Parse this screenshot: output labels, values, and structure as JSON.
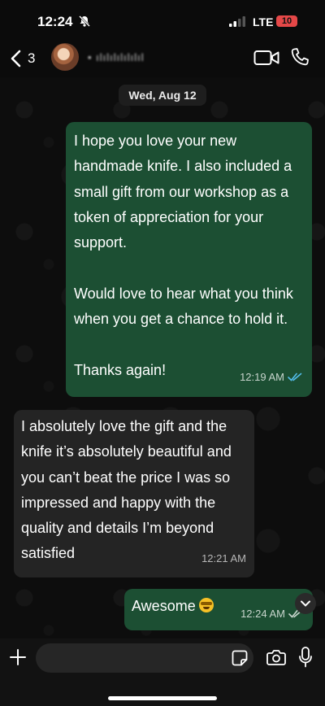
{
  "status_bar": {
    "time": "12:24",
    "carrier": "LTE",
    "battery": "10"
  },
  "header": {
    "unread_count": "3",
    "contact_name": "• ılılılılılılıl"
  },
  "date_chip": "Wed, Aug 12",
  "messages": [
    {
      "direction": "outgoing",
      "text": "I hope you love your new handmade knife. I also included a small gift from our workshop as a token of appreciation for your support.\n\nWould love to hear what you think when you get a chance to hold it.\n\nThanks again!",
      "time": "12:19 AM",
      "status": "read"
    },
    {
      "direction": "incoming",
      "text": "I absolutely love the gift and the knife it’s absolutely beautiful and you can’t beat the price I was so impressed and happy with the quality and details I’m beyond satisfied",
      "time": "12:21 AM"
    },
    {
      "direction": "outgoing",
      "text": "Awesome",
      "emoji": "star-struck-emoji",
      "time": "12:24 AM",
      "status": "delivered"
    }
  ],
  "composer": {
    "placeholder": ""
  },
  "colors": {
    "outgoing": "#1c4f33",
    "incoming": "#242424",
    "read_ticks": "#53bdeb",
    "battery": "#e54848"
  }
}
